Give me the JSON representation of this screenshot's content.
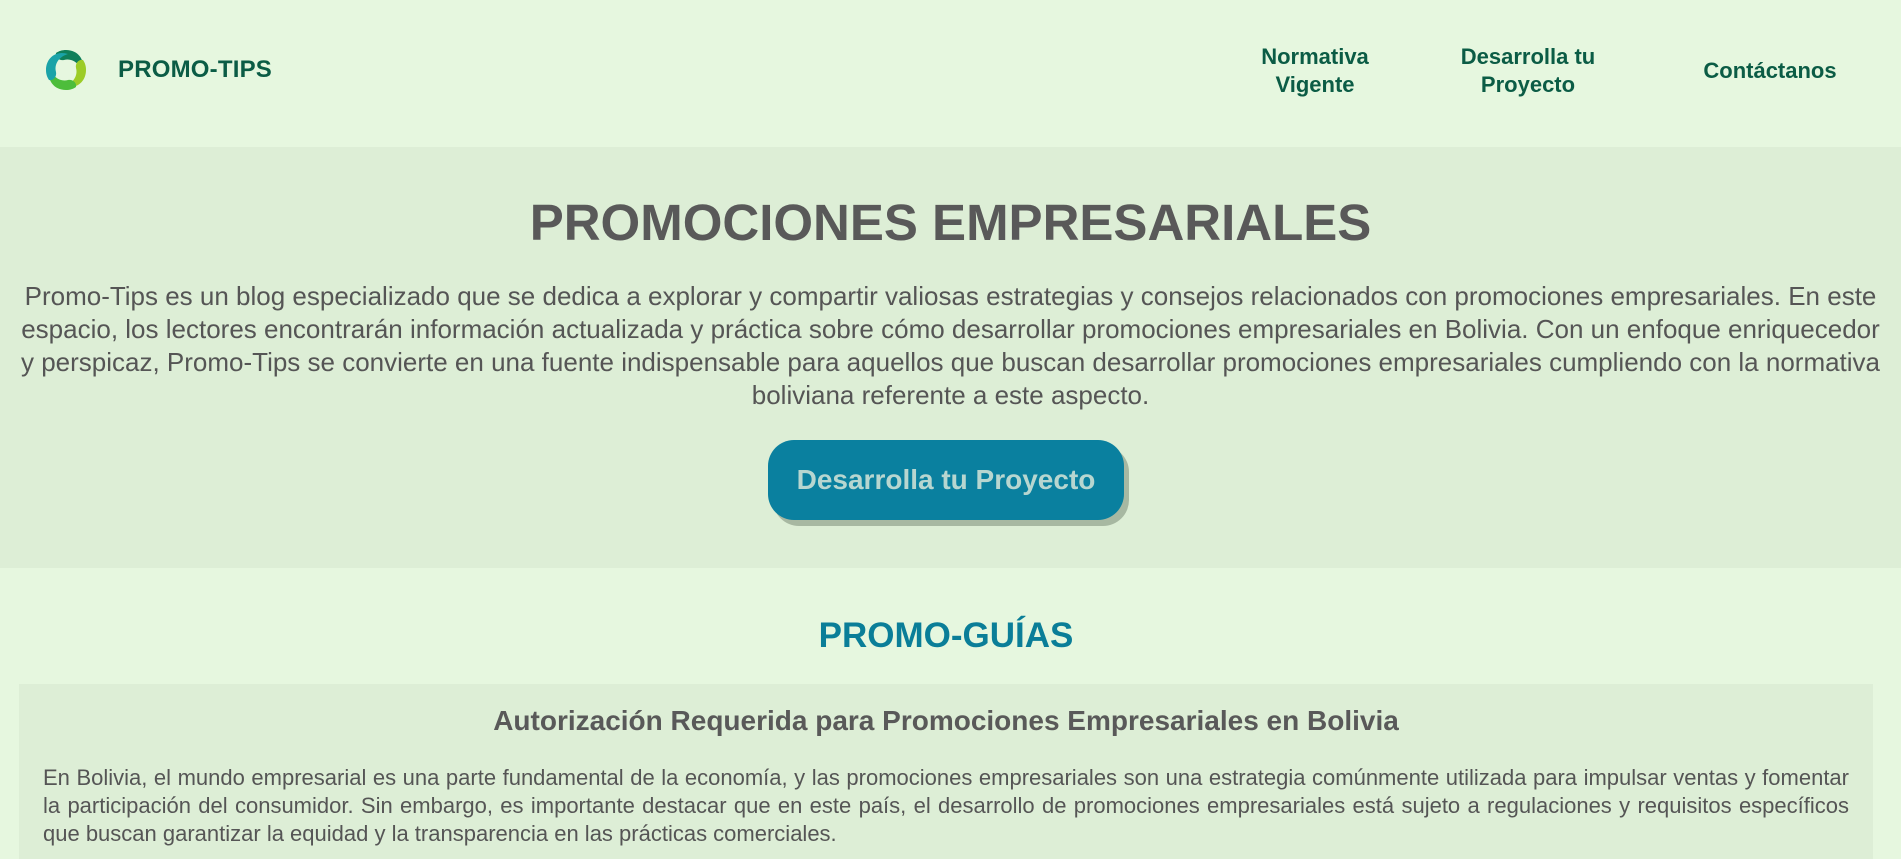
{
  "header": {
    "brand_name": "PROMO-TIPS",
    "logo_icon": "swirl-logo-icon",
    "nav": {
      "normativa": [
        "Normativa",
        "Vigente"
      ],
      "proyecto": [
        "Desarrolla tu",
        "Proyecto"
      ],
      "contacto": "Contáctanos"
    }
  },
  "hero": {
    "title": "PROMOCIONES EMPRESARIALES",
    "text": "Promo-Tips es un blog especializado que se dedica a explorar y compartir valiosas estrategias y consejos relacionados con promociones empresariales. En este espacio, los lectores encontrarán información actualizada y práctica sobre cómo desarrollar promociones empresariales en Bolivia. Con un enfoque enriquecedor y perspicaz, Promo-Tips se convierte en una fuente indispensable para aquellos que buscan desarrollar promociones empresariales cumpliendo con la normativa boliviana referente a este aspecto.",
    "cta_label": "Desarrolla tu Proyecto"
  },
  "guides": {
    "section_title": "PROMO-GUÍAS",
    "items": [
      {
        "title": "Autorización Requerida para Promociones Empresariales en Bolivia",
        "text": "En Bolivia, el mundo empresarial es una parte fundamental de la economía, y las promociones empresariales son una estrategia comúnmente utilizada para impulsar ventas y fomentar la participación del consumidor. Sin embargo, es importante destacar que en este país, el desarrollo de promociones empresariales está sujeto a regulaciones y requisitos específicos que buscan garantizar la equidad y la transparencia en las prácticas comerciales."
      }
    ]
  },
  "colors": {
    "page_background": "#e6f7df",
    "section_background": "#ddeed6",
    "nav_text": "#0b5c45",
    "accent": "#0a809f",
    "guides_title": "#0a7e98",
    "body_text": "#555555"
  }
}
